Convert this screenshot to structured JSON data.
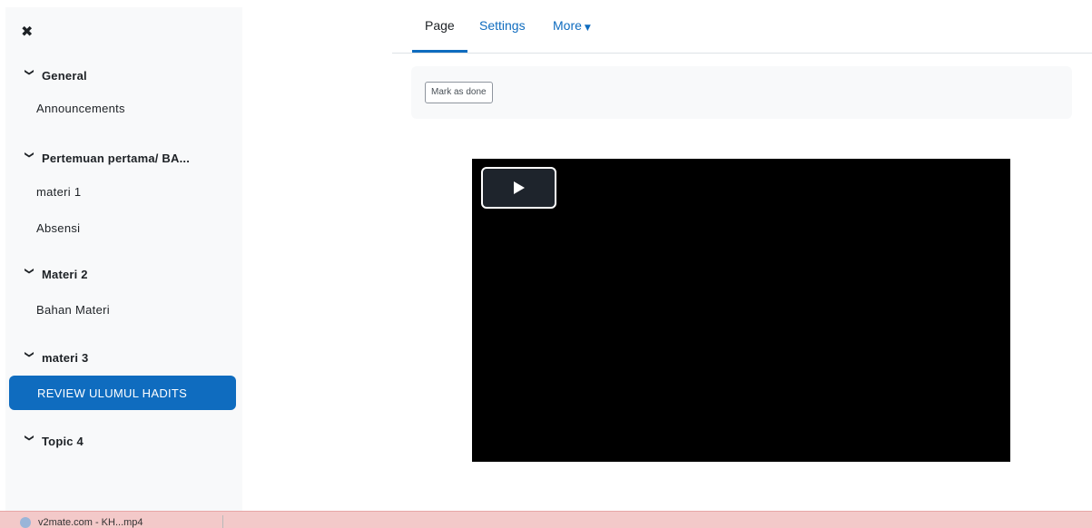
{
  "drawer": {
    "close_icon": "✖",
    "sections": [
      {
        "title": "General",
        "items": [
          "Announcements"
        ]
      },
      {
        "title": "Pertemuan pertama/ BA...",
        "items": [
          "materi 1",
          "Absensi"
        ]
      },
      {
        "title": "Materi 2",
        "items": [
          "Bahan Materi"
        ]
      },
      {
        "title": "materi 3",
        "items": [
          "REVIEW ULUMUL HADITS"
        ]
      },
      {
        "title": "Topic 4",
        "items": []
      }
    ],
    "active_item": "REVIEW ULUMUL HADITS"
  },
  "tabs": {
    "page": "Page",
    "settings": "Settings",
    "more": "More",
    "active": "Page"
  },
  "activity": {
    "mark_done": "Mark as done"
  },
  "video": {
    "play_icon": "play-icon",
    "background": "#000000"
  },
  "download_bar": {
    "file_name": "v2mate.com - KH...mp4"
  },
  "colors": {
    "accent": "#0f6cbf",
    "drawer_bg": "#f8f9fa",
    "download_bar_bg": "#f3c9c9"
  }
}
